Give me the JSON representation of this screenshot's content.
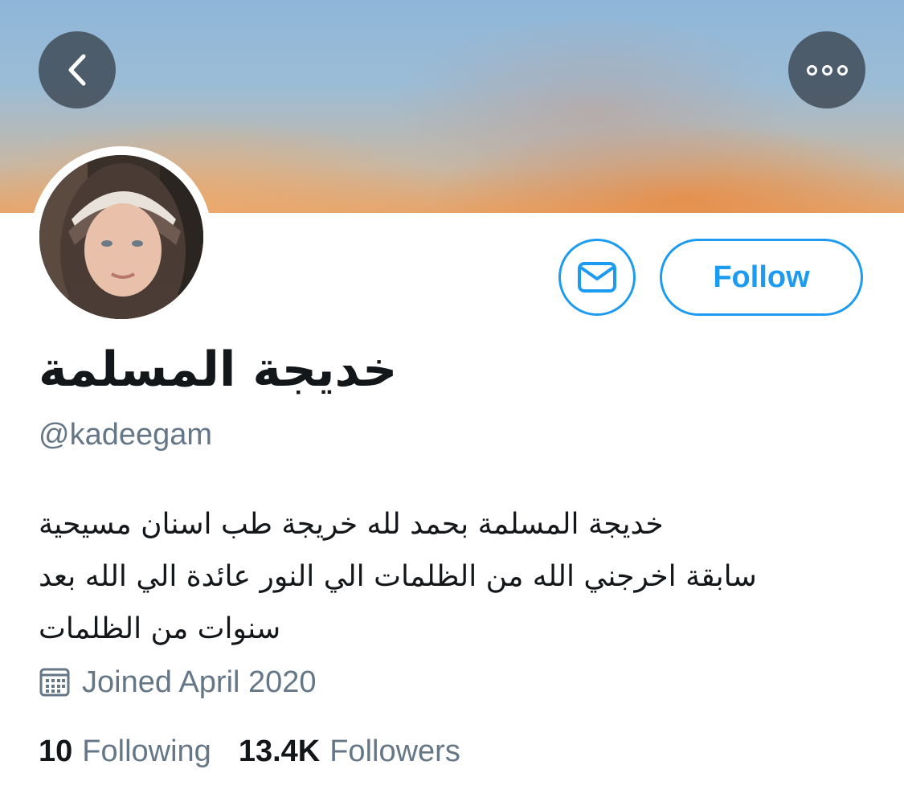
{
  "profile": {
    "display_name": "خديجة المسلمة",
    "handle": "@kadeegam",
    "bio_lines": [
      "خديجة المسلمة بحمد لله خريجة طب اسنان مسيحية",
      "سابقة اخرجني الله من الظلمات الي النور عائدة الي الله بعد",
      "سنوات من الظلمات"
    ],
    "joined": "Joined April 2020"
  },
  "actions": {
    "follow_label": "Follow"
  },
  "stats": {
    "following_count": "10",
    "following_label": "Following",
    "followers_count": "13.4K",
    "followers_label": "Followers"
  },
  "icons": {
    "back": "back-chevron-icon",
    "more": "more-options-icon",
    "message": "envelope-icon",
    "calendar": "calendar-icon"
  },
  "colors": {
    "accent": "#1d9bf0",
    "text_primary": "#14171a",
    "text_secondary": "#657786"
  }
}
